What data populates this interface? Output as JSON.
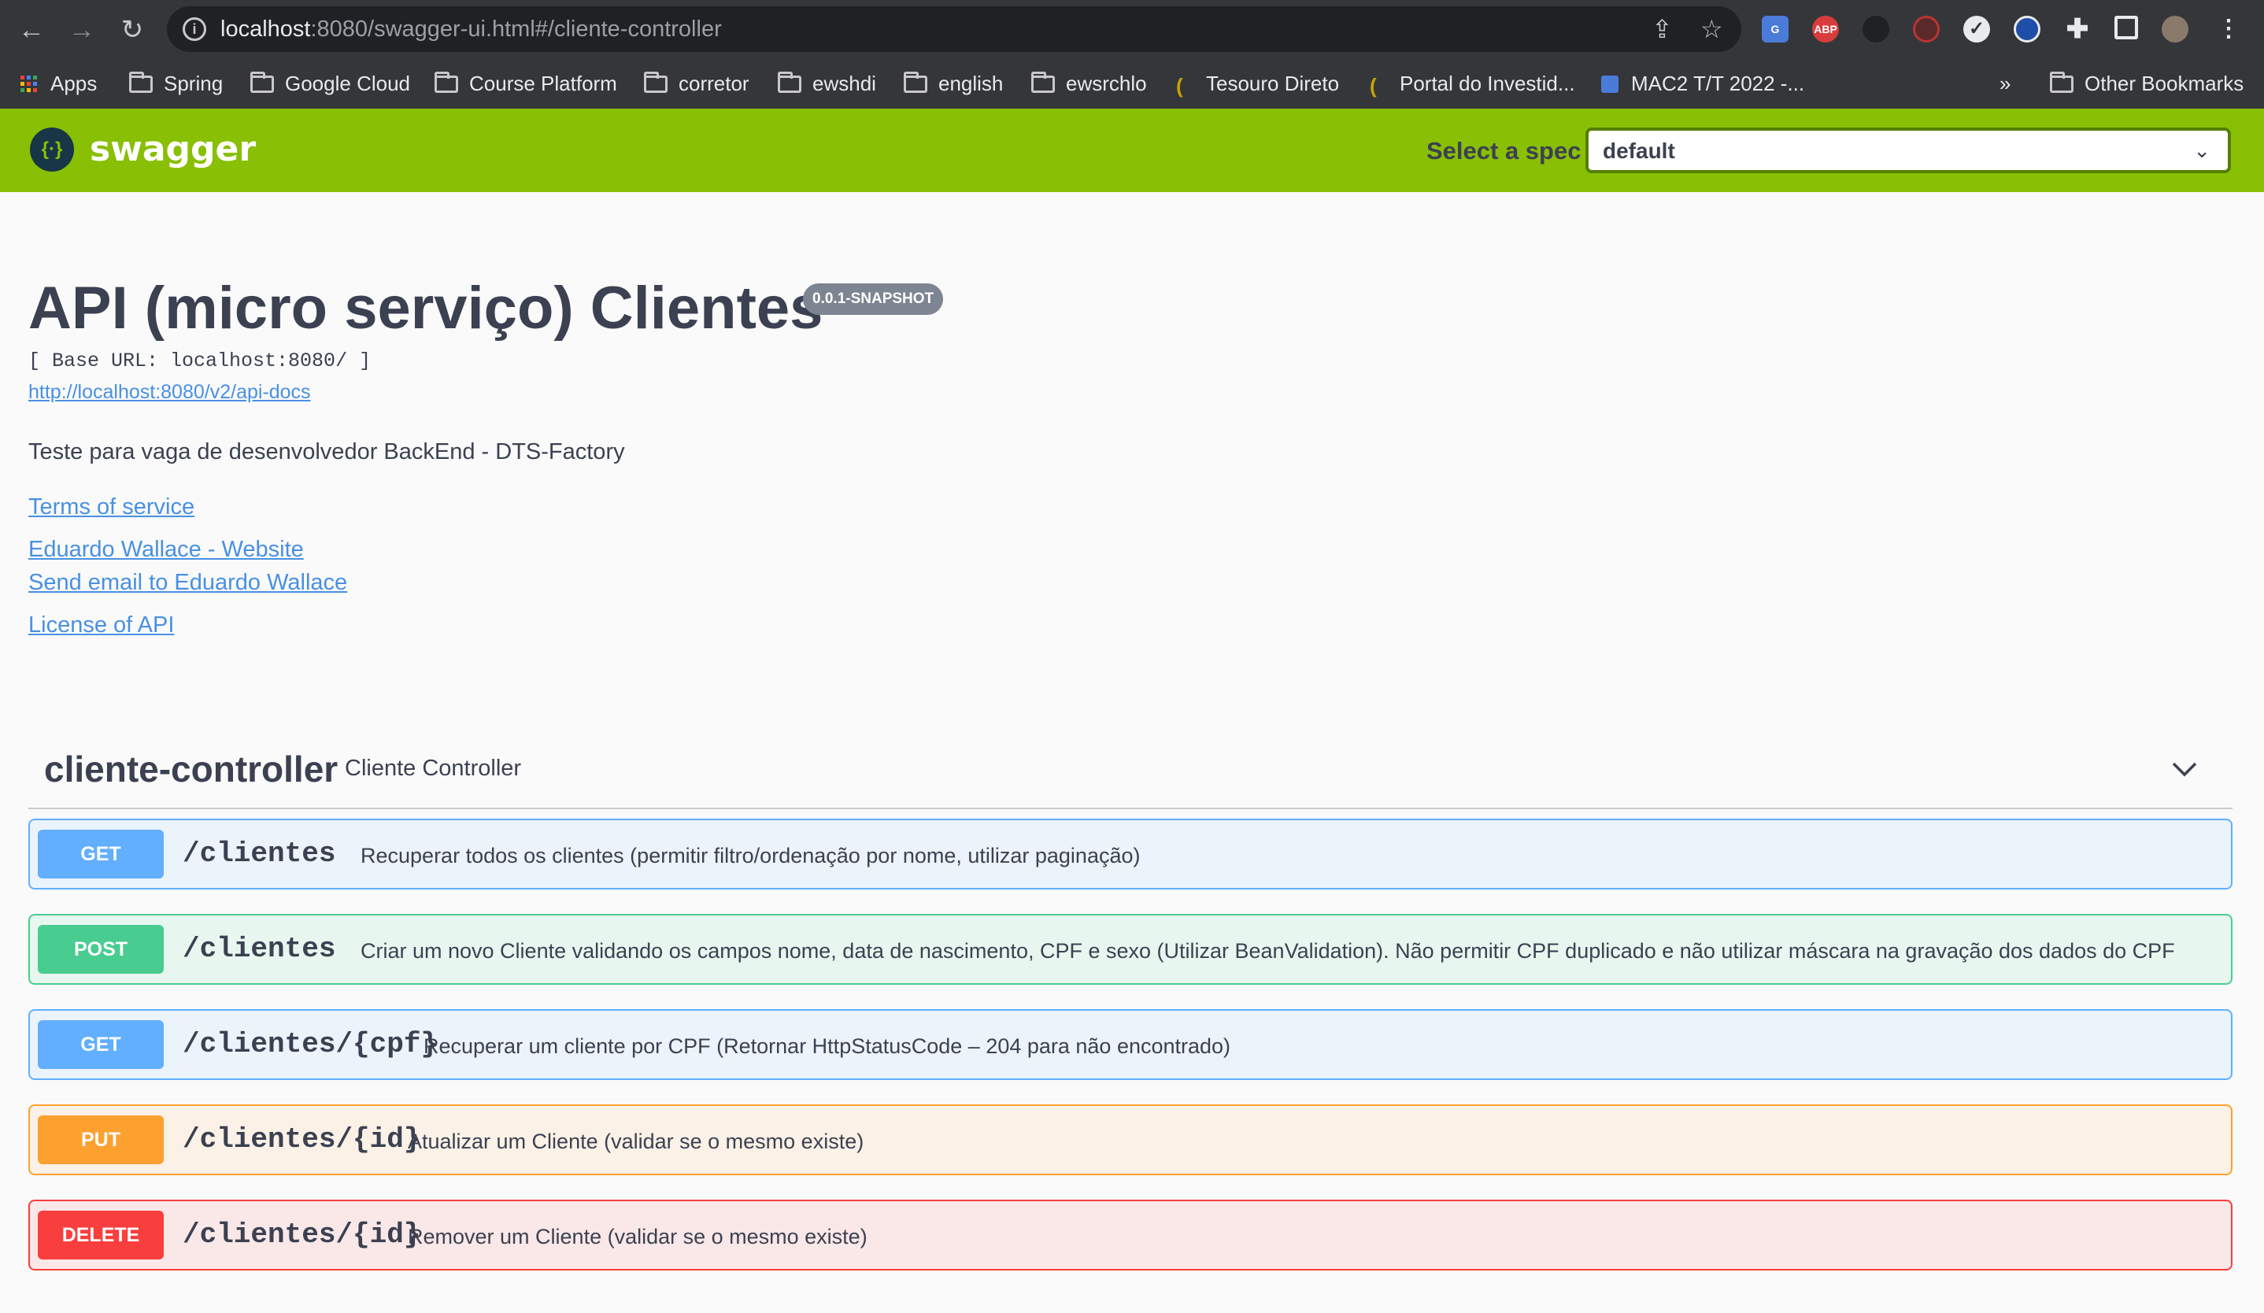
{
  "browser": {
    "url_host": "localhost",
    "url_rest": ":8080/swagger-ui.html#/cliente-controller",
    "bookmarks": [
      {
        "label": "Apps",
        "icon": "apps-grid-icon"
      },
      {
        "label": "Spring",
        "icon": "folder-icon"
      },
      {
        "label": "Google Cloud",
        "icon": "folder-icon"
      },
      {
        "label": "Course Platform",
        "icon": "folder-icon"
      },
      {
        "label": "corretor",
        "icon": "folder-icon"
      },
      {
        "label": "ewshdi",
        "icon": "folder-icon"
      },
      {
        "label": "english",
        "icon": "folder-icon"
      },
      {
        "label": "ewsrchlo",
        "icon": "folder-icon"
      },
      {
        "label": "Tesouro Direto",
        "icon": "tesouro-favicon"
      },
      {
        "label": "Portal do Investid...",
        "icon": "tesouro-favicon"
      },
      {
        "label": "MAC2 T/T 2022 -...",
        "icon": "docs-favicon"
      }
    ],
    "overflow": "»",
    "other_bookmarks": "Other Bookmarks"
  },
  "topbar": {
    "logo_text": "swagger",
    "spec_label": "Select a spec",
    "spec_value": "default"
  },
  "info": {
    "title": "API (micro serviço) Clientes",
    "version": "0.0.1-SNAPSHOT",
    "base_url": "[ Base URL: localhost:8080/ ]",
    "api_docs_link": "http://localhost:8080/v2/api-docs",
    "description": "Teste para vaga de desenvolvedor BackEnd - DTS-Factory",
    "terms": "Terms of service",
    "website": "Eduardo Wallace - Website",
    "email": "Send email to Eduardo Wallace",
    "license": "License of API"
  },
  "tag": {
    "name": "cliente-controller",
    "description": "Cliente Controller"
  },
  "operations": [
    {
      "method": "GET",
      "path": "/clientes",
      "summary": "Recuperar todos os clientes (permitir filtro/ordenação por nome, utilizar paginação)"
    },
    {
      "method": "POST",
      "path": "/clientes",
      "summary": "Criar um novo Cliente validando os campos nome, data de nascimento, CPF e sexo (Utilizar BeanValidation). Não permitir CPF duplicado e não utilizar máscara na gravação dos dados do CPF"
    },
    {
      "method": "GET",
      "path": "/clientes/{cpf}",
      "summary": "Recuperar um cliente por CPF (Retornar HttpStatusCode – 204 para não encontrado)"
    },
    {
      "method": "PUT",
      "path": "/clientes/{id}",
      "summary": "Atualizar um Cliente (validar se o mesmo existe)"
    },
    {
      "method": "DELETE",
      "path": "/clientes/{id}",
      "summary": "Remover um Cliente (validar se o mesmo existe)"
    }
  ]
}
